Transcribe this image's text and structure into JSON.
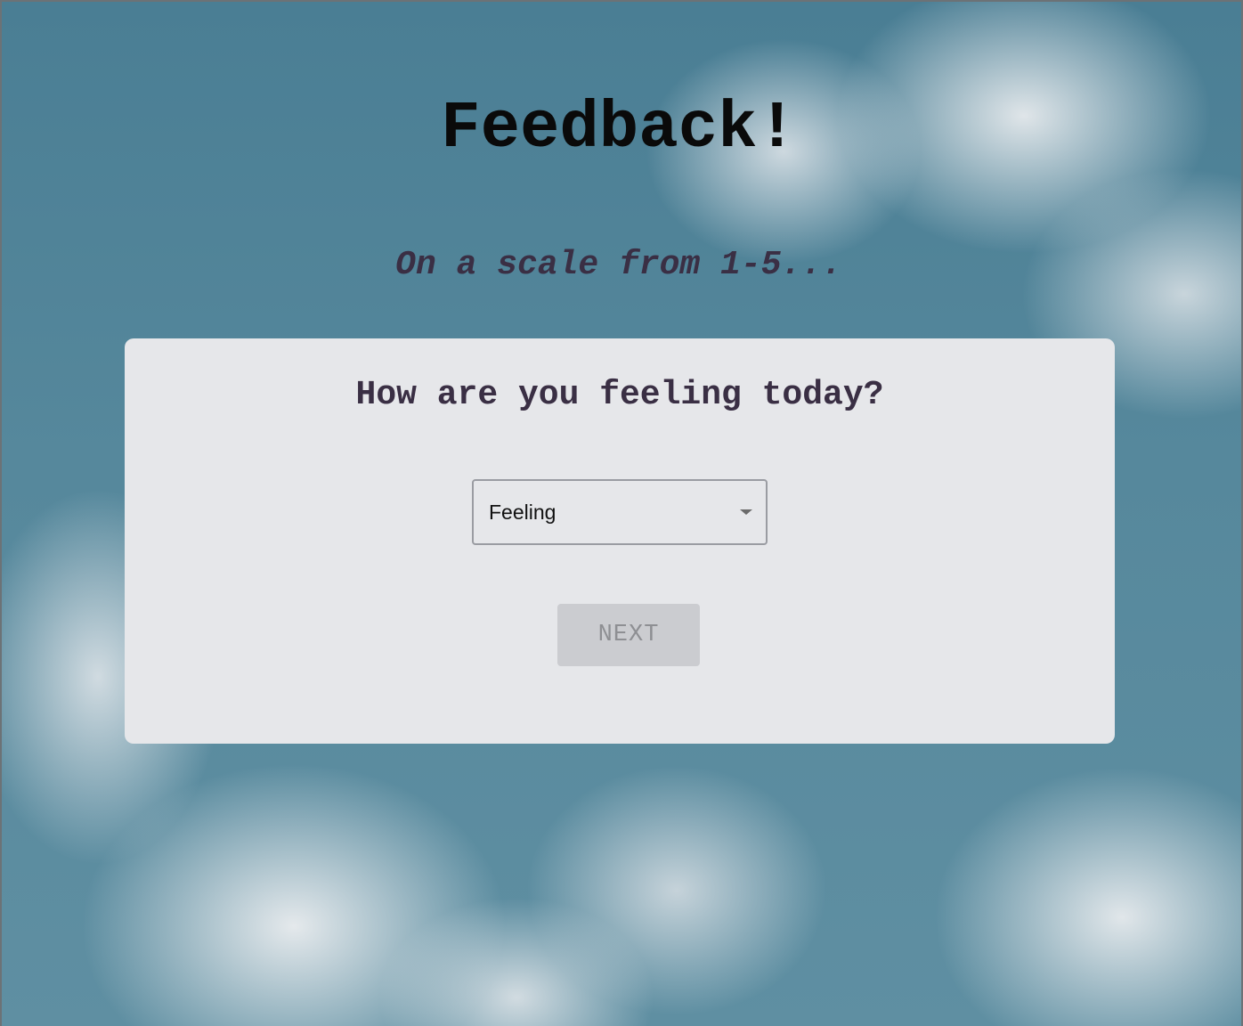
{
  "page": {
    "title": "Feedback!",
    "subtitle": "On a scale from 1-5..."
  },
  "card": {
    "question": "How are you feeling today?",
    "select": {
      "selected_value": "Feeling",
      "icon": "caret-down-icon"
    },
    "next_button": {
      "label": "NEXT",
      "state": "disabled"
    }
  },
  "colors": {
    "title_text": "#0a0a0a",
    "subtitle_text": "#3a2f44",
    "card_background": "#e6e7ea",
    "button_disabled_bg": "#cbccd0",
    "button_disabled_text": "#8e8f93",
    "sky": "#56889c"
  }
}
